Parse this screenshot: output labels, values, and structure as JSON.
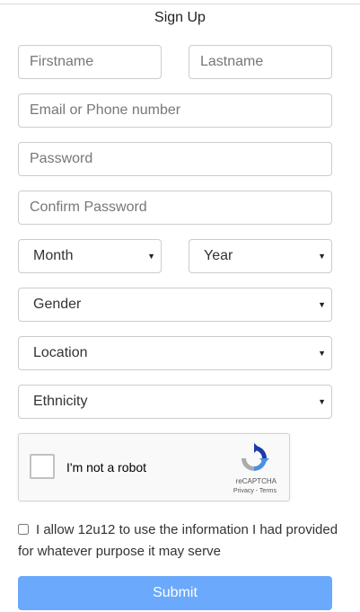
{
  "form": {
    "title": "Sign Up",
    "firstname_placeholder": "Firstname",
    "lastname_placeholder": "Lastname",
    "email_placeholder": "Email or Phone number",
    "password_placeholder": "Password",
    "confirm_password_placeholder": "Confirm Password",
    "month_selected": "Month",
    "year_selected": "Year",
    "gender_selected": "Gender",
    "location_selected": "Location",
    "ethnicity_selected": "Ethnicity",
    "consent_text": "I allow 12u12 to use the information I had provided for whatever purpose it may serve",
    "submit_label": "Submit"
  },
  "captcha": {
    "label": "I'm not a robot",
    "brand": "reCAPTCHA",
    "terms": "Privacy - Terms"
  },
  "icons": {
    "select_arrow": "caret-down",
    "captcha_logo": "recaptcha-logo"
  },
  "colors": {
    "submit_bg": "#6aa9fb",
    "input_border": "#cccccc"
  }
}
